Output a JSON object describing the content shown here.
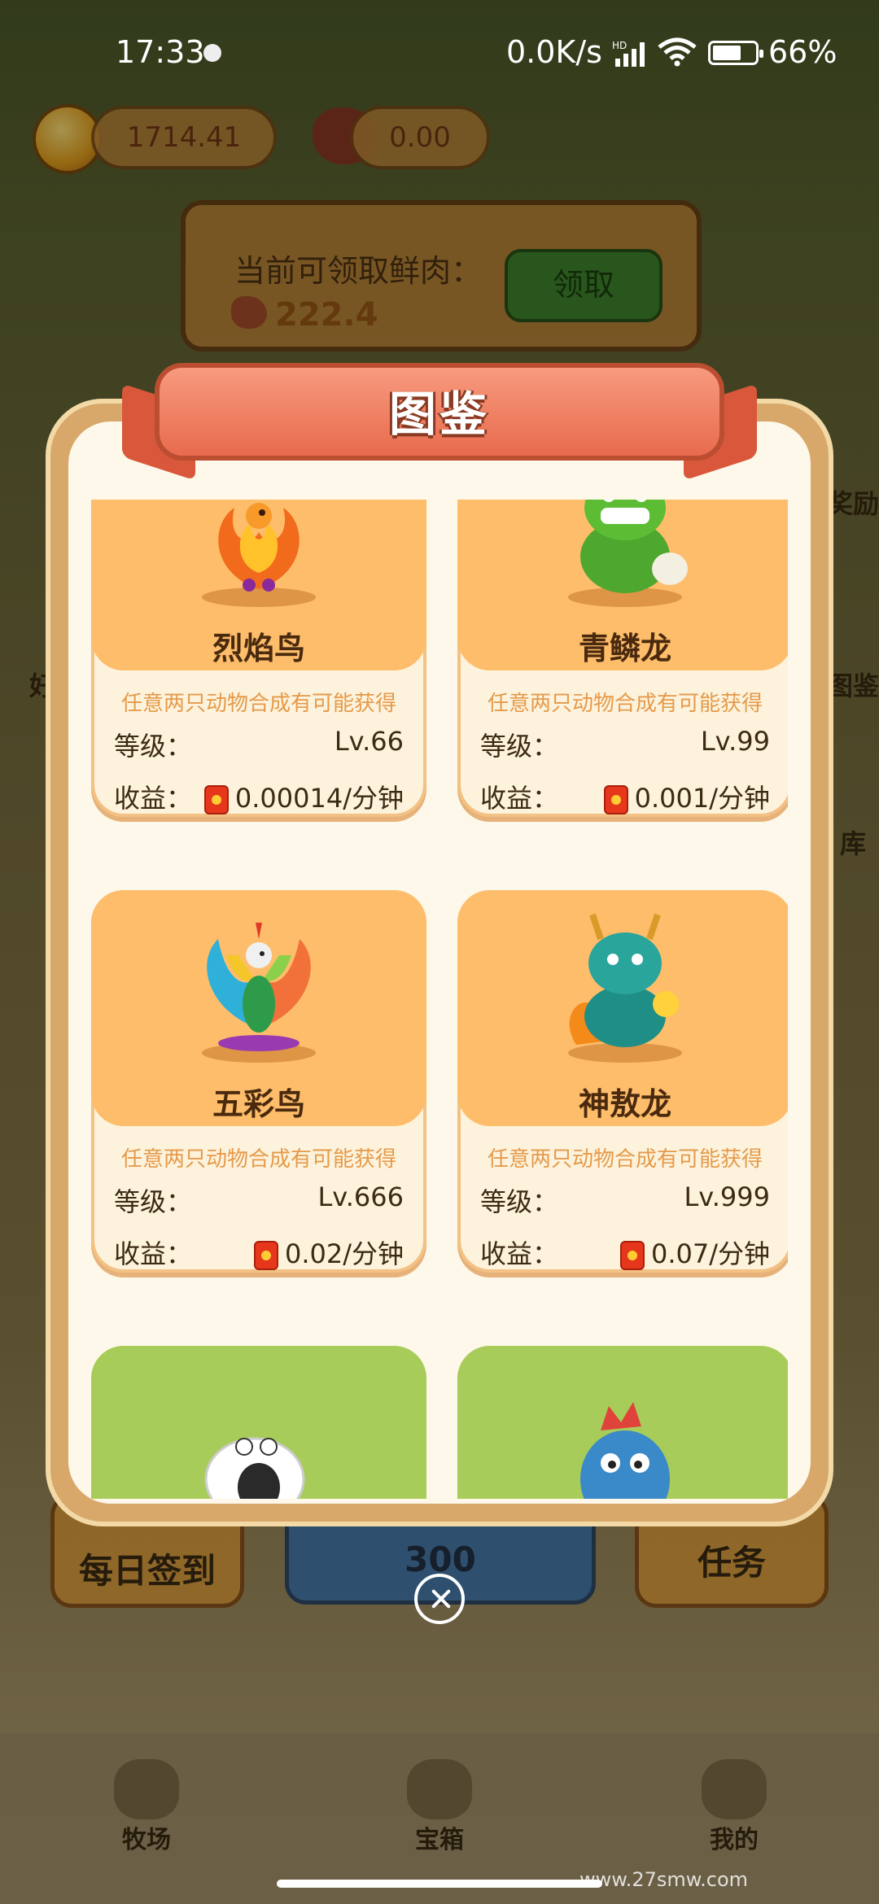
{
  "status_bar": {
    "time": "17:33",
    "network_speed": "0.0K/s",
    "network_badge": "HD",
    "battery": "66%"
  },
  "top_bar": {
    "coin_value": "1714.41",
    "meat_value": "0.00"
  },
  "claim_panel": {
    "title": "当前可领取鲜肉：",
    "amount": "222.4",
    "button": "领取"
  },
  "side_labels": {
    "right_1": "奖励",
    "right_2": "图鉴",
    "right_3": "库",
    "left_1": "好"
  },
  "bottom_buttons": {
    "checkin": "每日签到",
    "price": "300",
    "tasks": "任务"
  },
  "tabbar": {
    "items": [
      {
        "label": "牧场",
        "icon": "sheep-icon"
      },
      {
        "label": "宝箱",
        "icon": "chest-icon"
      },
      {
        "label": "我的",
        "icon": "duck-icon"
      }
    ]
  },
  "watermark": "www.27smw.com",
  "modal": {
    "title": "图鉴",
    "cards": [
      {
        "name": "烈焰鸟",
        "desc": "任意两只动物合成有可能获得",
        "level_label": "等级：",
        "level": "Lv.66",
        "income_label": "收益：",
        "income": "0.00014/分钟",
        "creature": "flame-bird",
        "theme": "orange"
      },
      {
        "name": "青鳞龙",
        "desc": "任意两只动物合成有可能获得",
        "level_label": "等级：",
        "level": "Lv.99",
        "income_label": "收益：",
        "income": "0.001/分钟",
        "creature": "green-dragon",
        "theme": "orange"
      },
      {
        "name": "五彩鸟",
        "desc": "任意两只动物合成有可能获得",
        "level_label": "等级：",
        "level": "Lv.666",
        "income_label": "收益：",
        "income": "0.02/分钟",
        "creature": "rainbow-bird",
        "theme": "orange"
      },
      {
        "name": "神敖龙",
        "desc": "任意两只动物合成有可能获得",
        "level_label": "等级：",
        "level": "Lv.999",
        "income_label": "收益：",
        "income": "0.07/分钟",
        "creature": "divine-dragon",
        "theme": "orange"
      },
      {
        "creature": "sheep",
        "theme": "green"
      },
      {
        "creature": "blue-dino",
        "theme": "green"
      }
    ]
  },
  "colors": {
    "card_top": "#fdbd6a",
    "card_green": "#a8cc5a",
    "banner": "#e86b4e",
    "desc": "#e59a4a"
  }
}
